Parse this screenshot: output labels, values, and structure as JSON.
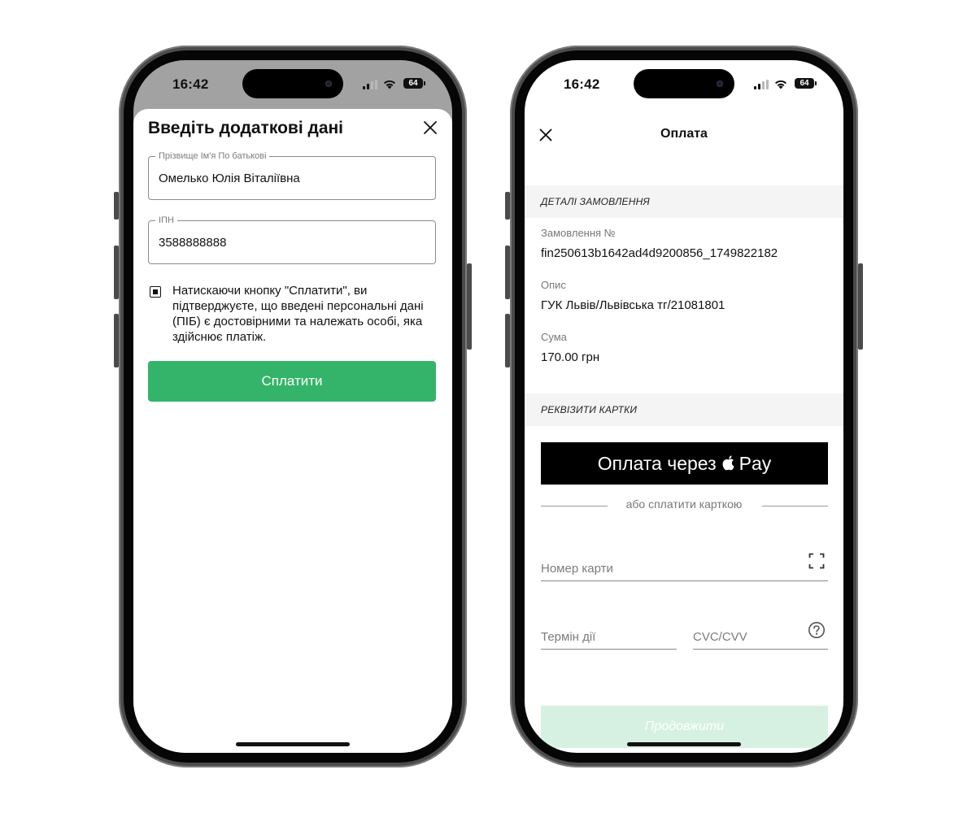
{
  "status_bar": {
    "time": "16:42",
    "battery": "64"
  },
  "additional_data_sheet": {
    "title": "Введіть додаткові дані",
    "full_name_field": {
      "label": "Прізвище Ім'я По батькові",
      "value": "Омелько Юлія Віталіївна"
    },
    "tax_id_field": {
      "label": "ІПН",
      "value": "3588888888"
    },
    "consent_checked": true,
    "consent_text": "Натискаючи кнопку \"Сплатити\", ви підтверджуєте, що введені персональні дані (ПІБ) є достовірними та належать особі, яка здійснює платіж.",
    "pay_button": "Сплатити"
  },
  "payment_screen": {
    "title": "Оплата",
    "order_details_header": "ДЕТАЛІ ЗАМОВЛЕННЯ",
    "order_number_label": "Замовлення №",
    "order_number": "fin250613b1642ad4d9200856_1749822182",
    "description_label": "Опис",
    "description": "ГУК Львів/Львівська тг/21081801",
    "amount_label": "Сума",
    "amount": "170.00 грн",
    "card_details_header": "РЕКВІЗИТИ КАРТКИ",
    "apple_pay_prefix": "Оплата через",
    "apple_pay_suffix": "Pay",
    "or_pay_by_card": "або сплатити карткою",
    "card_number_placeholder": "Номер карти",
    "expiry_placeholder": "Термін дії",
    "cvc_placeholder": "CVC/CVV",
    "continue_button": "Продовжити"
  },
  "colors": {
    "pay_green": "#34b46a",
    "continue_disabled": "#d6f1e1",
    "apple_pay_black": "#000000"
  }
}
